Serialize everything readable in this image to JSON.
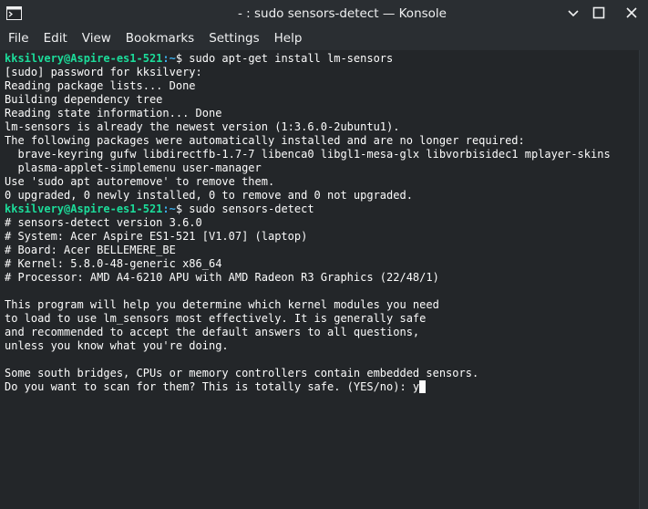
{
  "window": {
    "title": "- : sudo sensors-detect — Konsole",
    "icon": "terminal-icon",
    "controls": [
      "minimize-icon",
      "maximize-icon",
      "close-icon"
    ]
  },
  "menu": {
    "items": [
      "File",
      "Edit",
      "View",
      "Bookmarks",
      "Settings",
      "Help"
    ]
  },
  "terminal": {
    "prompt_user": "kksilvery@Aspire-es1-521",
    "prompt_path": ":~",
    "lines": [
      {
        "type": "prompt",
        "cmd": "$ sudo apt-get install lm-sensors"
      },
      {
        "type": "text",
        "text": "[sudo] password for kksilvery:"
      },
      {
        "type": "text",
        "text": "Reading package lists... Done"
      },
      {
        "type": "text",
        "text": "Building dependency tree"
      },
      {
        "type": "text",
        "text": "Reading state information... Done"
      },
      {
        "type": "text",
        "text": "lm-sensors is already the newest version (1:3.6.0-2ubuntu1)."
      },
      {
        "type": "text",
        "text": "The following packages were automatically installed and are no longer required:"
      },
      {
        "type": "text",
        "text": "  brave-keyring gufw libdirectfb-1.7-7 libenca0 libgl1-mesa-glx libvorbisidec1 mplayer-skins"
      },
      {
        "type": "text",
        "text": "  plasma-applet-simplemenu user-manager"
      },
      {
        "type": "text",
        "text": "Use 'sudo apt autoremove' to remove them."
      },
      {
        "type": "text",
        "text": "0 upgraded, 0 newly installed, 0 to remove and 0 not upgraded."
      },
      {
        "type": "prompt",
        "cmd": "$ sudo sensors-detect"
      },
      {
        "type": "text",
        "text": "# sensors-detect version 3.6.0"
      },
      {
        "type": "text",
        "text": "# System: Acer Aspire ES1-521 [V1.07] (laptop)"
      },
      {
        "type": "text",
        "text": "# Board: Acer BELLEMERE_BE"
      },
      {
        "type": "text",
        "text": "# Kernel: 5.8.0-48-generic x86_64"
      },
      {
        "type": "text",
        "text": "# Processor: AMD A4-6210 APU with AMD Radeon R3 Graphics (22/48/1)"
      },
      {
        "type": "text",
        "text": ""
      },
      {
        "type": "text",
        "text": "This program will help you determine which kernel modules you need"
      },
      {
        "type": "text",
        "text": "to load to use lm_sensors most effectively. It is generally safe"
      },
      {
        "type": "text",
        "text": "and recommended to accept the default answers to all questions,"
      },
      {
        "type": "text",
        "text": "unless you know what you're doing."
      },
      {
        "type": "text",
        "text": ""
      },
      {
        "type": "text",
        "text": "Some south bridges, CPUs or memory controllers contain embedded sensors."
      },
      {
        "type": "input",
        "text": "Do you want to scan for them? This is totally safe. (YES/no): y"
      }
    ]
  }
}
